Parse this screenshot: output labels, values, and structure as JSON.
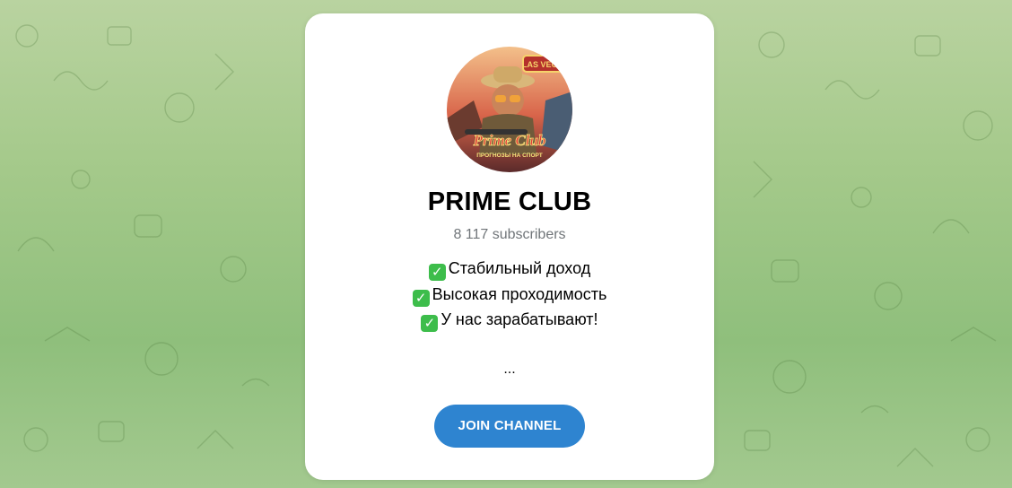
{
  "channel": {
    "title": "PRIME CLUB",
    "subscribers": "8 117 subscribers",
    "description": [
      {
        "check_icon": "check-mark-emoji-icon",
        "text": "Стабильный доход"
      },
      {
        "check_icon": "check-mark-emoji-icon",
        "text": "Высокая проходимость"
      },
      {
        "check_icon": "check-mark-emoji-icon",
        "text": "У нас зарабатывают!"
      }
    ],
    "ellipsis": "...",
    "avatar": {
      "icon": "channel-avatar",
      "logo_text": "Prime Club",
      "logo_subtext": "ПРОГНОЗЫ НА СПОРТ",
      "sign_text": "LAS VEGAS"
    }
  },
  "actions": {
    "join_label": "JOIN CHANNEL"
  },
  "colors": {
    "button": "#2e84d0",
    "subtitle": "#707579",
    "background": "#a4c98a",
    "check": "#3dbd4b"
  }
}
